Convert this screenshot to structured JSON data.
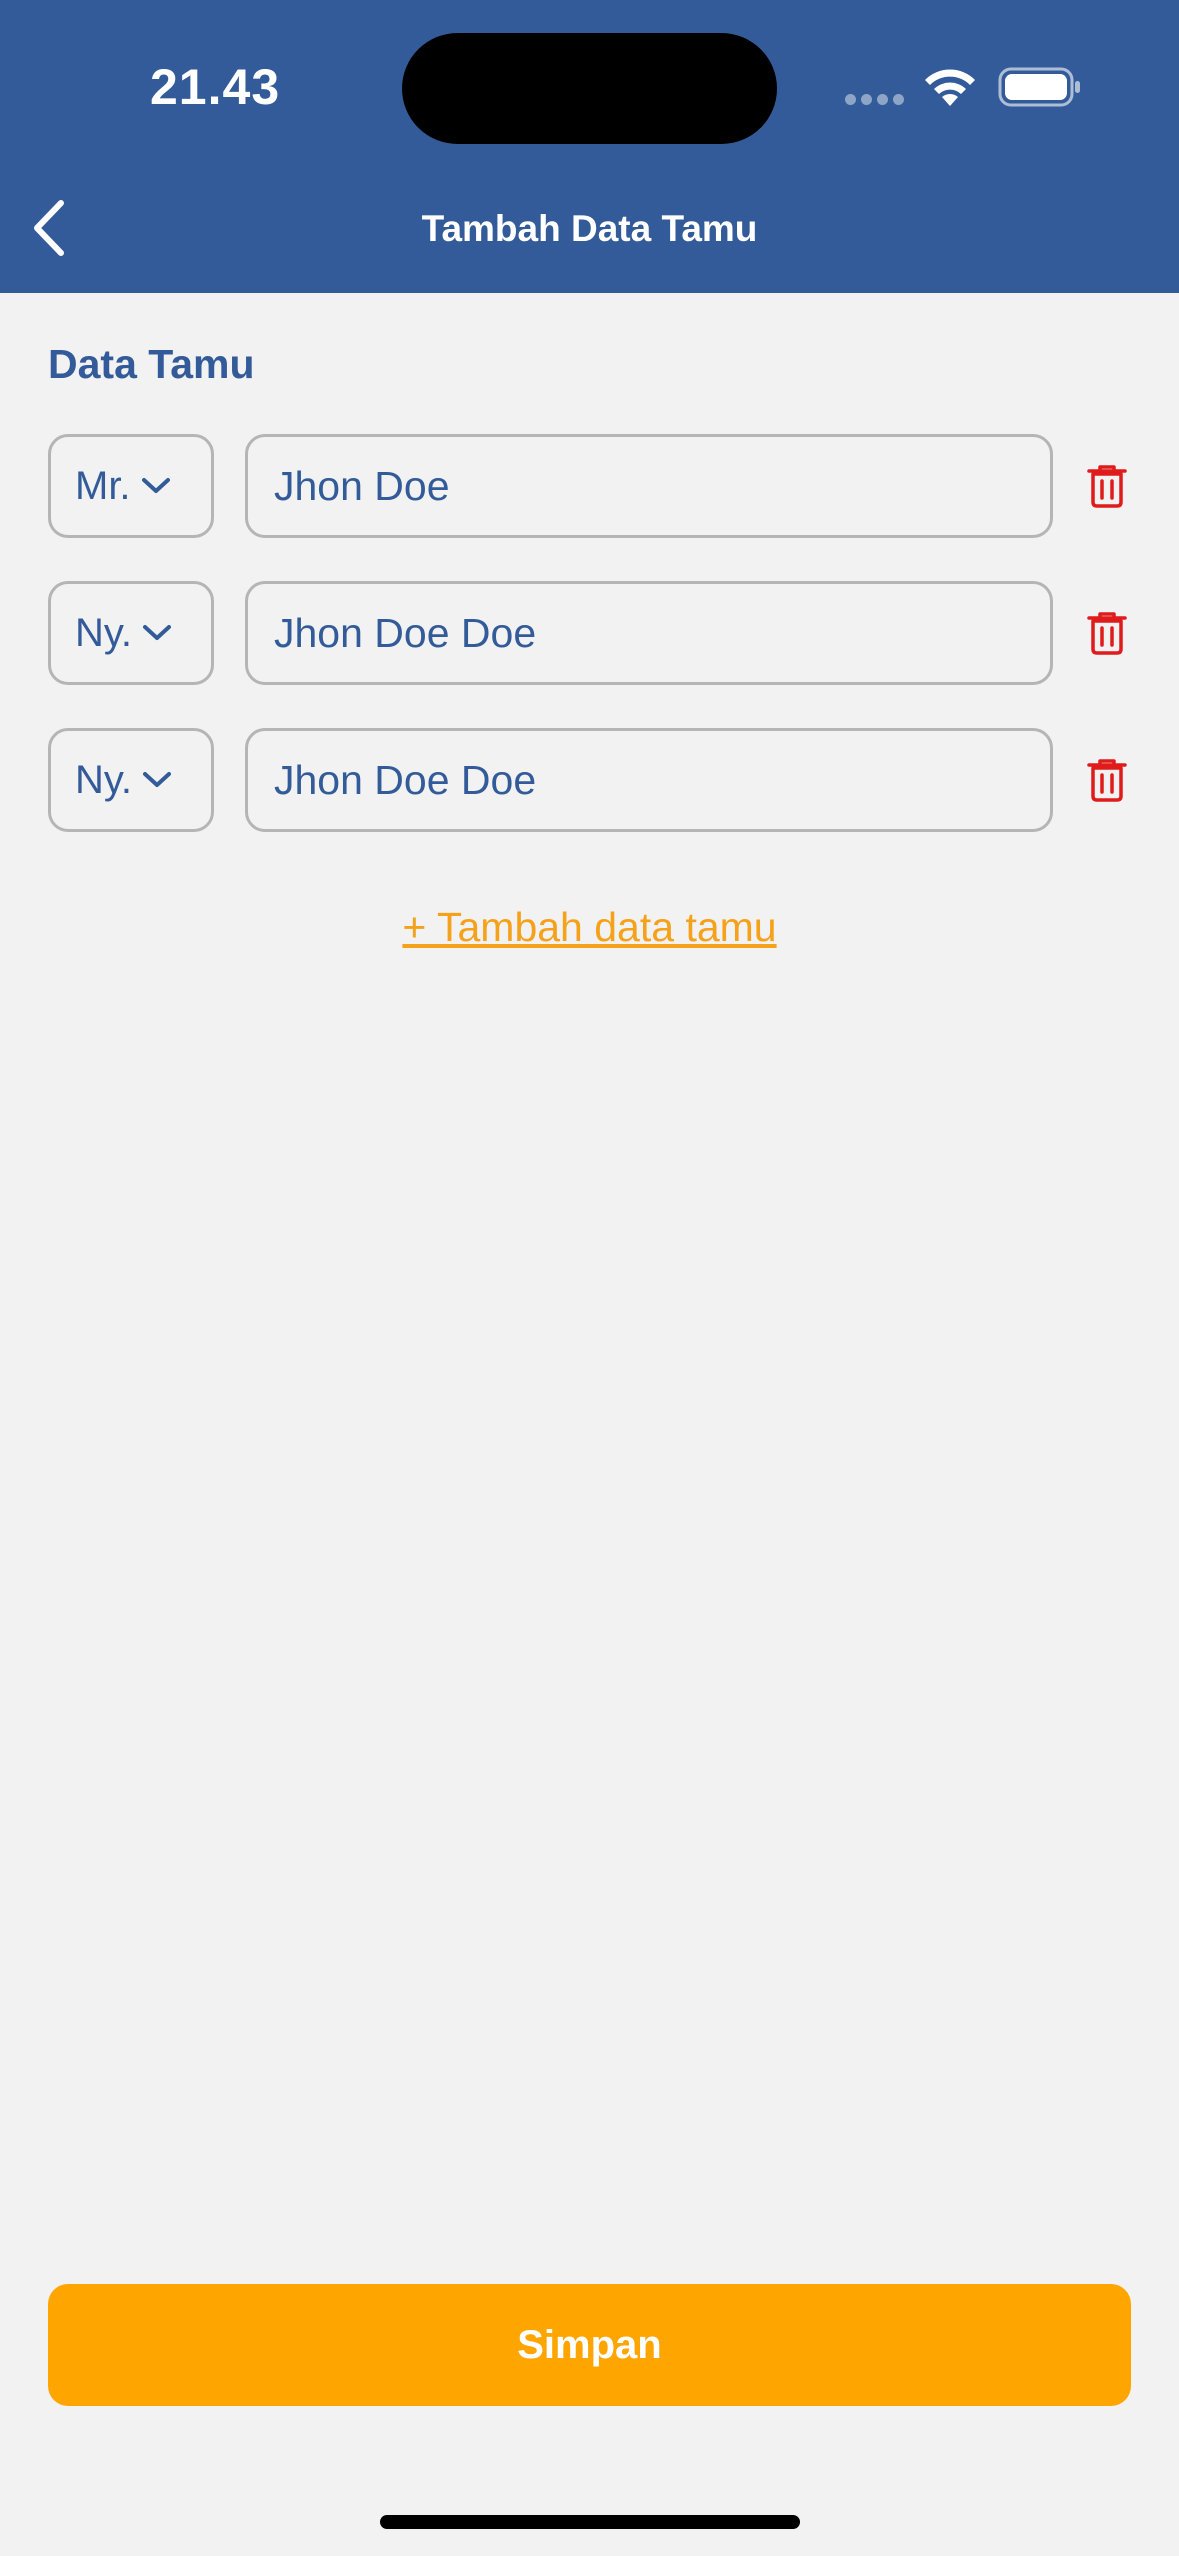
{
  "status_bar": {
    "time": "21.43"
  },
  "header": {
    "title": "Tambah Data Tamu",
    "back_icon": "chevron-left-icon"
  },
  "section": {
    "title": "Data Tamu"
  },
  "guests": [
    {
      "salutation": "Mr.",
      "name": "Jhon Doe"
    },
    {
      "salutation": "Ny.",
      "name": "Jhon Doe Doe"
    },
    {
      "salutation": "Ny.",
      "name": "Jhon Doe Doe"
    }
  ],
  "add_guest_label": "+ Tambah data tamu",
  "save_label": "Simpan",
  "colors": {
    "primary": "#335b99",
    "accent": "#ffa500",
    "link": "#f5a11a",
    "delete": "#e01b1b",
    "background": "#f2f2f2"
  }
}
